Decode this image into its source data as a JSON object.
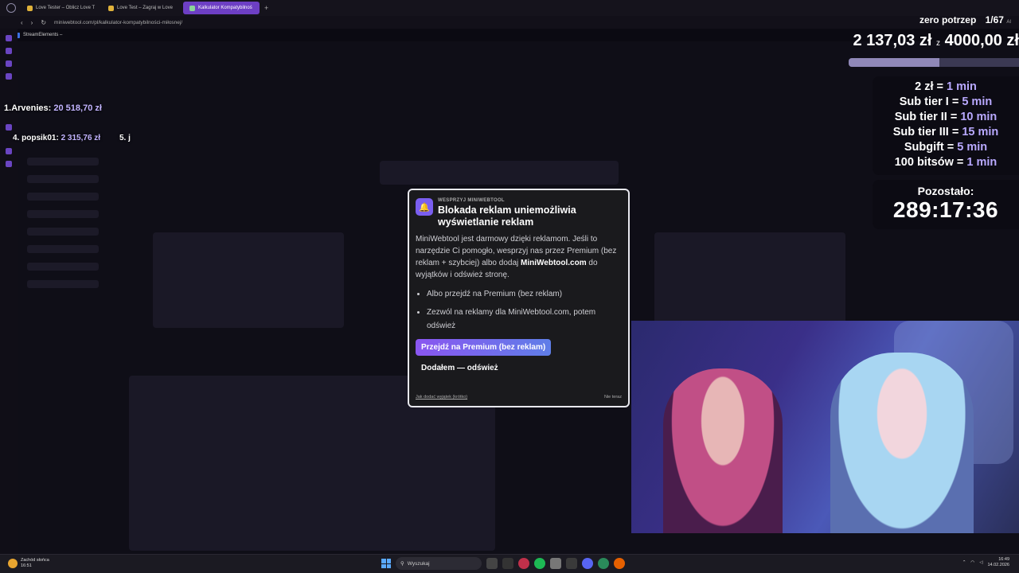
{
  "browser": {
    "tabs": [
      {
        "label": "Love Tester – Oblicz Love T"
      },
      {
        "label": "Love Test – Zagraj w Love"
      },
      {
        "label": "Kalkulator Kompatybilnoś"
      }
    ],
    "url": "miniwebtool.com/pl/kalkulator-kompatybilności-miłosnej/",
    "bookmark": "StreamElements –"
  },
  "overlay": {
    "leaders": [
      {
        "rank": "1.",
        "name": "Arvenies:",
        "amount": "20 518,70 zł"
      },
      {
        "rank": "4.",
        "name": "popsik01:",
        "amount": "2 315,76 zł"
      },
      {
        "rank": "5.",
        "name": "j",
        "amount": ""
      }
    ],
    "goal_label": "zero potrzep",
    "goal_count": "1/67",
    "goal_ai": "AI",
    "raised": "2 137,03 zł",
    "goal_sep": "z",
    "target": "4000,00 zł",
    "progress": 0.534,
    "rates": [
      {
        "label": "2 zł =",
        "value": "1 min"
      },
      {
        "label": "Sub tier I =",
        "value": "5 min"
      },
      {
        "label": "Sub tier II =",
        "value": "10 min"
      },
      {
        "label": "Sub tier III =",
        "value": "15 min"
      },
      {
        "label": "Subgift =",
        "value": "5 min"
      },
      {
        "label": "100 bitsów =",
        "value": "1 min"
      }
    ],
    "remaining_label": "Pozostało:",
    "remaining_time": "289:17:36"
  },
  "modal": {
    "kicker": "WESPRZYJ MINIWEBTOOL",
    "title": "Blokada reklam uniemożliwia wyświetlanie reklam",
    "body_1": "MiniWebtool jest darmowy dzięki reklamom. Jeśli to narzędzie Ci pomogło, wesprzyj nas przez Premium (bez reklam + szybciej) albo dodaj ",
    "body_bold": "MiniWebtool.com",
    "body_2": " do wyjątków i odśwież stronę.",
    "options": [
      "Albo przejdź na Premium (bez reklam)",
      "Zezwól na reklamy dla MiniWebtool.com, potem odśwież"
    ],
    "premium_button": "Przejdź na Premium (bez reklam)",
    "done_button": "Dodałem — odśwież",
    "help_link": "Jak dodać wyjątek (krótko)",
    "not_now": "Nie teraz"
  },
  "taskbar": {
    "weather_title": "Zachód słońca",
    "weather_time": "16:51",
    "search_placeholder": "Wyszukaj",
    "time": "16:49",
    "date": "14.02.2026"
  }
}
